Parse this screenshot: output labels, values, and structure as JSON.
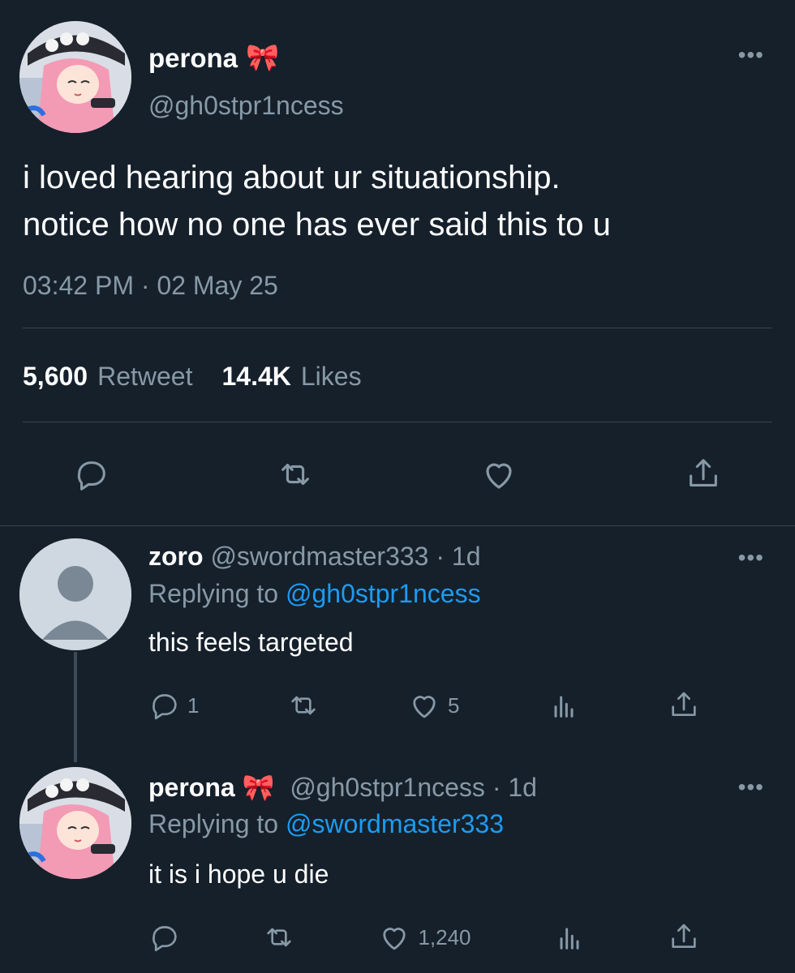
{
  "main_tweet": {
    "display_name": "perona",
    "name_emoji": "🎀",
    "handle": "@gh0stpr1ncess",
    "text_line1": "i loved hearing about ur situationship.",
    "text_line2": "notice how no one has ever said this to u",
    "timestamp": "03:42 PM · 02 May 25",
    "retweet_count": "5,600",
    "retweet_label": "Retweet",
    "likes_count": "14.4K",
    "likes_label": "Likes",
    "more_label": "•••"
  },
  "replies": [
    {
      "display_name": "zoro",
      "handle_time": "@swordmaster333 · 1d",
      "replying_prefix": "Replying to",
      "replying_to": "@gh0stpr1ncess",
      "text": "this feels targeted",
      "reply_count": "1",
      "like_count": "5",
      "more_label": "•••"
    },
    {
      "display_name": "perona",
      "name_emoji": "🎀",
      "handle_time": "@gh0stpr1ncess · 1d",
      "replying_prefix": "Replying to",
      "replying_to": "@swordmaster333",
      "text": "it is i hope u die",
      "like_count": "1,240",
      "more_label": "•••"
    }
  ],
  "colors": {
    "background": "#15202b",
    "muted": "#8899a6",
    "link": "#1d9bf0",
    "divider": "#38444d"
  },
  "icons": [
    "reply-icon",
    "retweet-icon",
    "like-icon",
    "share-icon",
    "analytics-icon",
    "more-icon"
  ]
}
